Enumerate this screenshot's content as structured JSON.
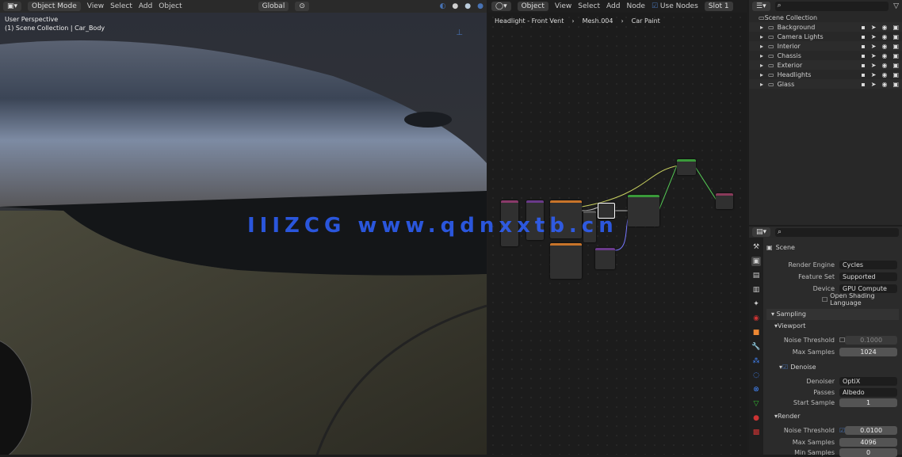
{
  "viewport_header": {
    "mode": "Object Mode",
    "menus": [
      "View",
      "Select",
      "Add",
      "Object"
    ],
    "orientation": "Global"
  },
  "viewport_overlay": {
    "view": "User Perspective",
    "collection": "(1) Scene Collection | Car_Body"
  },
  "node_header": {
    "type": "Object",
    "menus": [
      "View",
      "Select",
      "Add",
      "Node"
    ],
    "use_nodes": "Use Nodes",
    "slot": "Slot 1"
  },
  "breadcrumb": [
    "Headlight - Front Vent",
    "Mesh.004",
    "Car Paint"
  ],
  "outliner": {
    "root": "Scene Collection",
    "items": [
      "Background",
      "Camera Lights",
      "Interior",
      "Chassis",
      "Exterior",
      "Headlights",
      "Glass"
    ]
  },
  "properties": {
    "title": "Scene",
    "render_engine_label": "Render Engine",
    "render_engine": "Cycles",
    "feature_set_label": "Feature Set",
    "feature_set": "Supported",
    "device_label": "Device",
    "device": "GPU Compute",
    "osl": "Open Shading Language",
    "sampling": "Sampling",
    "viewport": "Viewport",
    "noise_threshold_label": "Noise Threshold",
    "viewport_noise": "0.1000",
    "max_samples_label": "Max Samples",
    "viewport_max": "1024",
    "denoise": "Denoise",
    "denoiser_label": "Denoiser",
    "denoiser": "OptiX",
    "passes_label": "Passes",
    "passes": "Albedo",
    "start_sample_label": "Start Sample",
    "start_sample": "1",
    "render": "Render",
    "render_noise": "0.0100",
    "render_max": "4096",
    "min_samples_label": "Min Samples",
    "min_samples": "0"
  },
  "watermark": "IIIZCG  www.qdnxxtb.cn",
  "colors": {
    "accent": "#4772b3",
    "node_green": "#3a9a3a"
  }
}
